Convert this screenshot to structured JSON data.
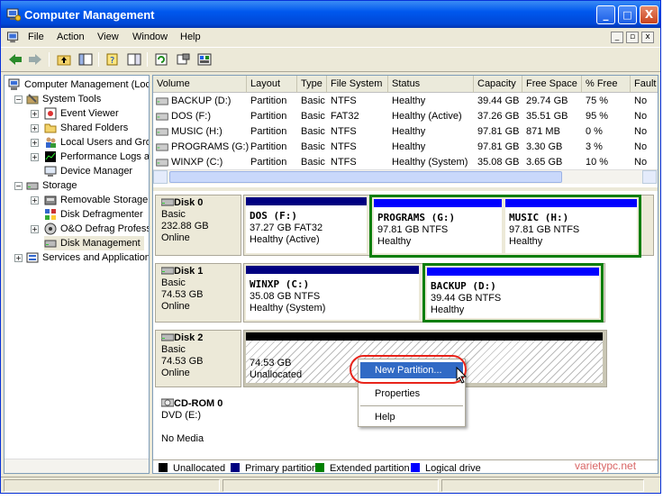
{
  "window": {
    "title": "Computer Management",
    "minimize_glyph": "_",
    "maximize_glyph": "□",
    "close_glyph": "X"
  },
  "menu": [
    "File",
    "Action",
    "View",
    "Window",
    "Help"
  ],
  "tree": [
    {
      "label": "Computer Management (Loc",
      "icon": "computer-icon"
    },
    {
      "label": "System Tools",
      "icon": "tools-icon"
    },
    {
      "label": "Event Viewer",
      "icon": "event-viewer-icon"
    },
    {
      "label": "Shared Folders",
      "icon": "folder-icon"
    },
    {
      "label": "Local Users and Gro",
      "icon": "users-icon"
    },
    {
      "label": "Performance Logs a",
      "icon": "performance-icon"
    },
    {
      "label": "Device Manager",
      "icon": "device-manager-icon"
    },
    {
      "label": "Storage",
      "icon": "storage-icon"
    },
    {
      "label": "Removable Storage",
      "icon": "removable-storage-icon"
    },
    {
      "label": "Disk Defragmenter",
      "icon": "defrag-icon"
    },
    {
      "label": "O&O Defrag Profess",
      "icon": "defrag-icon"
    },
    {
      "label": "Disk Management",
      "icon": "disk-management-icon"
    },
    {
      "label": "Services and Application",
      "icon": "services-icon"
    }
  ],
  "volume_list": {
    "columns": [
      "Volume",
      "Layout",
      "Type",
      "File System",
      "Status",
      "Capacity",
      "Free Space",
      "% Free",
      "Fault"
    ],
    "rows": [
      [
        "BACKUP (D:)",
        "Partition",
        "Basic",
        "NTFS",
        "Healthy",
        "39.44 GB",
        "29.74 GB",
        "75 %",
        "No"
      ],
      [
        "DOS (F:)",
        "Partition",
        "Basic",
        "FAT32",
        "Healthy (Active)",
        "37.26 GB",
        "35.51 GB",
        "95 %",
        "No"
      ],
      [
        "MUSIC (H:)",
        "Partition",
        "Basic",
        "NTFS",
        "Healthy",
        "97.81 GB",
        "871 MB",
        "0 %",
        "No"
      ],
      [
        "PROGRAMS (G:)",
        "Partition",
        "Basic",
        "NTFS",
        "Healthy",
        "97.81 GB",
        "3.30 GB",
        "3 %",
        "No"
      ],
      [
        "WINXP (C:)",
        "Partition",
        "Basic",
        "NTFS",
        "Healthy (System)",
        "35.08 GB",
        "3.65 GB",
        "10 %",
        "No"
      ]
    ]
  },
  "disks": [
    {
      "name": "Disk 0",
      "type": "Basic",
      "size": "232.88 GB",
      "status": "Online",
      "partitions": [
        {
          "name": "DOS  (F:)",
          "line2": "37.27 GB FAT32",
          "line3": "Healthy (Active)",
          "kind": "primary"
        },
        {
          "name": "PROGRAMS  (G:)",
          "line2": "97.81 GB NTFS",
          "line3": "Healthy",
          "kind": "logical"
        },
        {
          "name": "MUSIC  (H:)",
          "line2": "97.81 GB NTFS",
          "line3": "Healthy",
          "kind": "logical"
        }
      ]
    },
    {
      "name": "Disk 1",
      "type": "Basic",
      "size": "74.53 GB",
      "status": "Online",
      "partitions": [
        {
          "name": "WINXP  (C:)",
          "line2": "35.08 GB NTFS",
          "line3": "Healthy (System)",
          "kind": "primary"
        },
        {
          "name": "BACKUP  (D:)",
          "line2": "39.44 GB NTFS",
          "line3": "Healthy",
          "kind": "logical"
        }
      ]
    },
    {
      "name": "Disk 2",
      "type": "Basic",
      "size": "74.53 GB",
      "status": "Online",
      "partitions": [
        {
          "name": "",
          "line2": "74.53 GB",
          "line3": "Unallocated",
          "kind": "unallocated"
        }
      ]
    },
    {
      "name": "CD-ROM 0",
      "type": "DVD (E:)",
      "size": "",
      "status": "No Media",
      "partitions": []
    }
  ],
  "legend": [
    {
      "label": "Unallocated",
      "color": "#000000"
    },
    {
      "label": "Primary partition",
      "color": "#000080"
    },
    {
      "label": "Extended partition",
      "color": "#008000"
    },
    {
      "label": "Logical drive",
      "color": "#0000ff"
    }
  ],
  "context_menu": [
    "New Partition...",
    "Properties",
    "Help"
  ],
  "watermark": "varietypc.net",
  "colors": {
    "primary_bar": "#000080",
    "logical_bar": "#0000ff",
    "extended_border": "#0b7e0b",
    "unallocated_bar": "#000000",
    "highlight": "#316ac5",
    "annotation_ring": "#e8241b"
  }
}
